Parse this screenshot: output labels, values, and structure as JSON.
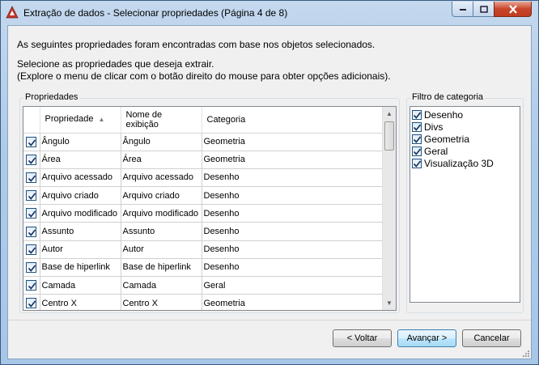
{
  "window": {
    "title": "Extração de dados - Selecionar propriedades (Página 4 de 8)"
  },
  "intro": {
    "line1": "As seguintes propriedades foram encontradas com base nos objetos selecionados.",
    "line2": "Selecione as propriedades que deseja extrair.",
    "line3": "(Explore o menu de clicar com o botão direito do mouse para obter opções adicionais)."
  },
  "properties": {
    "group_label": "Propriedades",
    "columns": [
      "Propriedade",
      "Nome de exibição",
      "Categoria"
    ],
    "sort_column": "Propriedade",
    "rows": [
      {
        "checked": true,
        "property": "Ângulo",
        "display": "Ângulo",
        "category": "Geometria"
      },
      {
        "checked": true,
        "property": "Área",
        "display": "Área",
        "category": "Geometria"
      },
      {
        "checked": true,
        "property": "Arquivo acessado",
        "display": "Arquivo acessado",
        "category": "Desenho"
      },
      {
        "checked": true,
        "property": "Arquivo criado",
        "display": "Arquivo criado",
        "category": "Desenho"
      },
      {
        "checked": true,
        "property": "Arquivo modificado",
        "display": "Arquivo modificado",
        "category": "Desenho"
      },
      {
        "checked": true,
        "property": "Assunto",
        "display": "Assunto",
        "category": "Desenho"
      },
      {
        "checked": true,
        "property": "Autor",
        "display": "Autor",
        "category": "Desenho"
      },
      {
        "checked": true,
        "property": "Base de hiperlink",
        "display": "Base de hiperlink",
        "category": "Desenho"
      },
      {
        "checked": true,
        "property": "Camada",
        "display": "Camada",
        "category": "Geral"
      },
      {
        "checked": true,
        "property": "Centro X",
        "display": "Centro X",
        "category": "Geometria"
      }
    ]
  },
  "filter": {
    "group_label": "Filtro de categoria",
    "items": [
      {
        "checked": true,
        "label": "Desenho"
      },
      {
        "checked": true,
        "label": "Divs"
      },
      {
        "checked": true,
        "label": "Geometria"
      },
      {
        "checked": true,
        "label": "Geral"
      },
      {
        "checked": true,
        "label": "Visualização 3D"
      }
    ]
  },
  "buttons": {
    "back": "< Voltar",
    "next": "Avançar >",
    "cancel": "Cancelar"
  },
  "colors": {
    "accent": "#3c7fb1",
    "close_button": "#c8452a",
    "app_icon": "#c0392b"
  }
}
